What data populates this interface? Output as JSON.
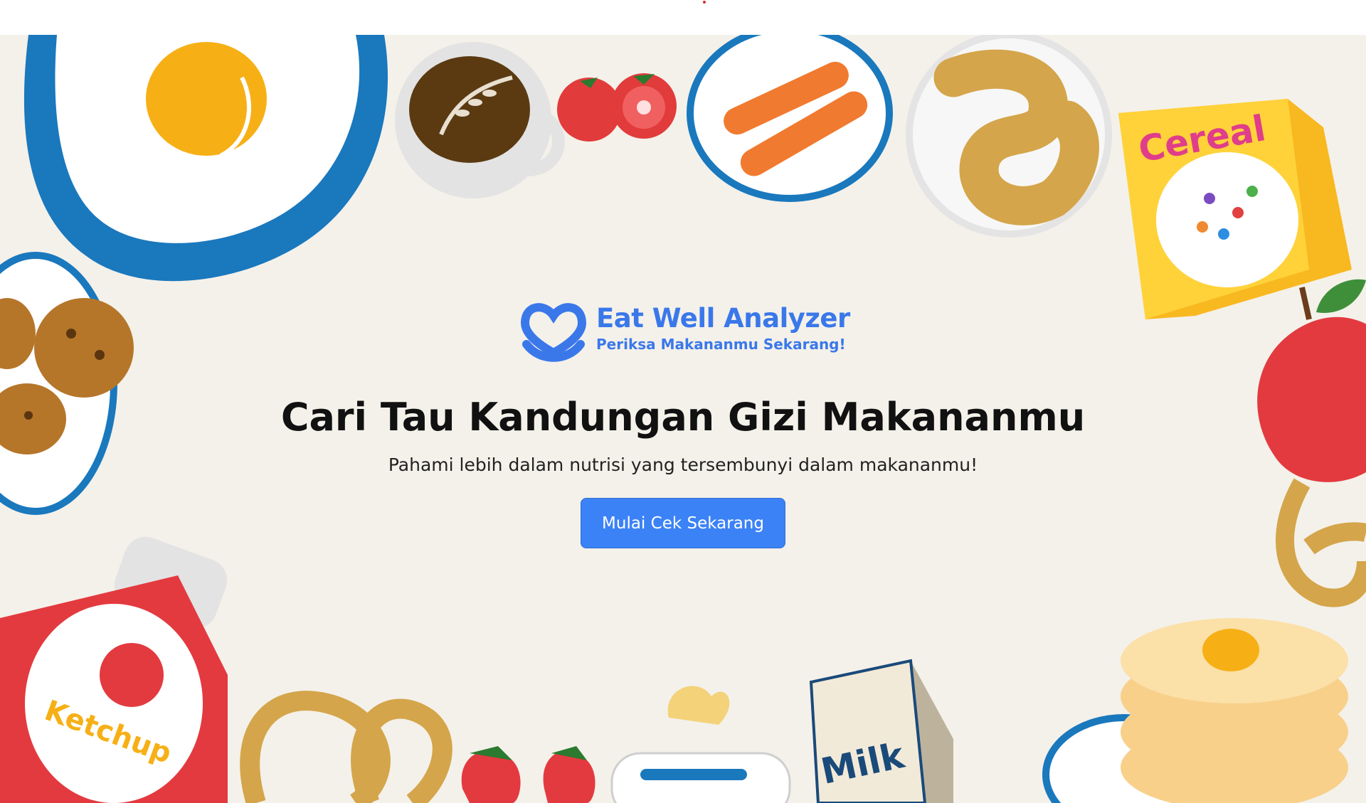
{
  "brand": {
    "name": "Eat Well Analyzer",
    "tagline": "Periksa Makananmu Sekarang!"
  },
  "hero": {
    "headline": "Cari Tau Kandungan Gizi Makananmu",
    "subheadline": "Pahami lebih dalam nutrisi yang tersembunyi dalam makananmu!",
    "cta_label": "Mulai Cek Sekarang"
  },
  "decor_labels": {
    "cereal": "Cereal",
    "ketchup": "Ketchup",
    "milk": "Milk"
  },
  "colors": {
    "accent": "#3b82f6",
    "brand": "#3a78ea",
    "background": "#f4f1ea"
  }
}
